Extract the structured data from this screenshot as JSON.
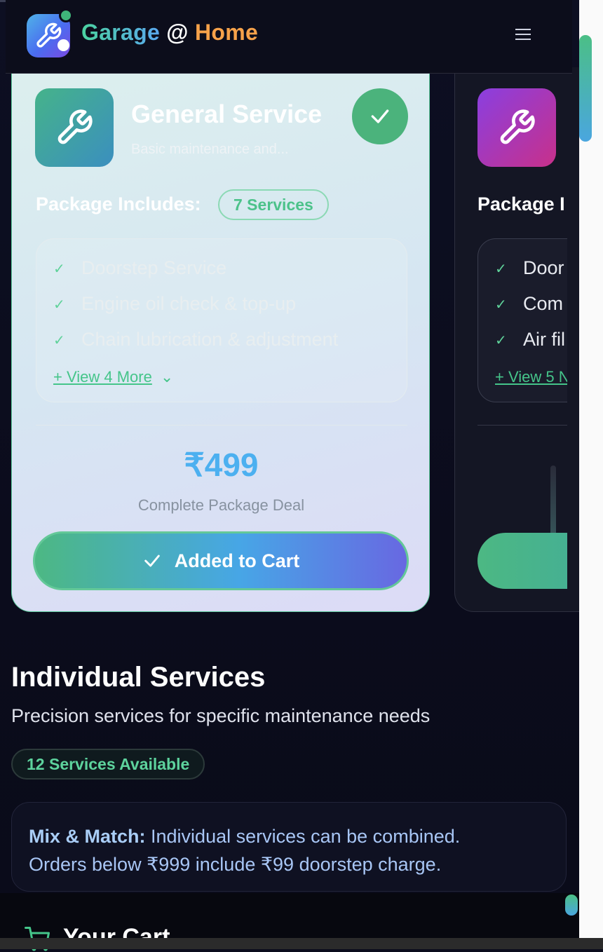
{
  "header": {
    "brand_part1": "Garage",
    "brand_at": "@",
    "brand_part2": "Home",
    "menu_icon": "hamburger-menu-icon"
  },
  "packages": [
    {
      "title": "General Service",
      "description": "Basic maintenance and...",
      "includes_label": "Package Includes:",
      "services_badge": "7 Services",
      "items": [
        "Doorstep Service",
        "Engine oil check & top-up",
        "Chain lubrication & adjustment"
      ],
      "view_more": "+ View 4 More",
      "price": "₹499",
      "price_note": "Complete Package Deal",
      "button": "Added to Cart",
      "selected": true,
      "icon": "wrench-icon"
    },
    {
      "includes_label": "Package I",
      "items": [
        "Door",
        "Com",
        "Air fil"
      ],
      "view_more": "+ View 5 N",
      "icon": "wrench-icon"
    }
  ],
  "individual": {
    "title": "Individual Services",
    "subtitle": "Precision services for specific maintenance needs",
    "badge": "12 Services Available",
    "note_strong": "Mix & Match:",
    "note_line1": " Individual services can be combined.",
    "note_line2": "Orders below ₹999 include ₹99 doorstep charge."
  },
  "cart": {
    "title": "Your Cart"
  },
  "colors": {
    "accent_green": "#4bb37c",
    "accent_blue": "#4cb0f0",
    "accent_orange": "#f7a24a",
    "background": "#0b0c1c"
  }
}
